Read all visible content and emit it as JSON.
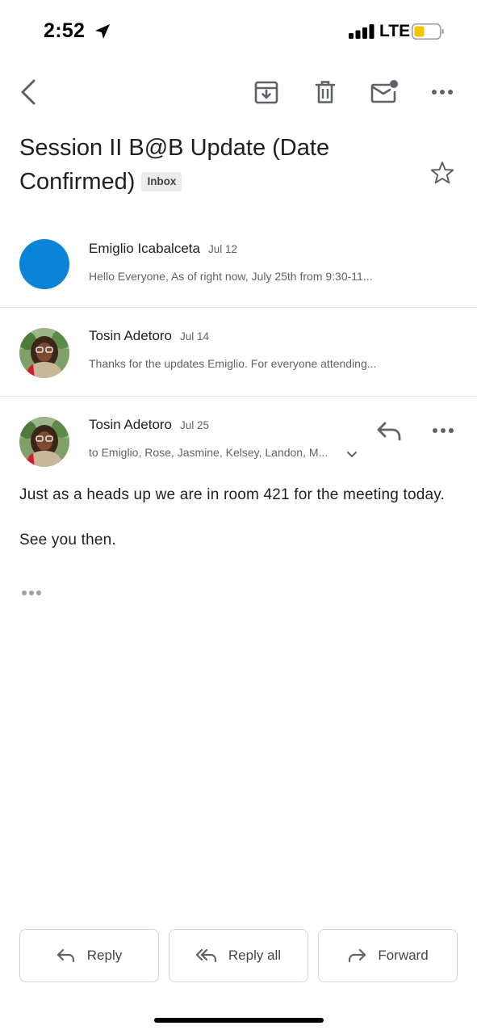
{
  "status_bar": {
    "time": "2:52",
    "network": "LTE"
  },
  "toolbar": {
    "back": "back-icon",
    "archive": "archive-icon",
    "delete": "trash-icon",
    "mark_unread": "mail-unread-icon",
    "more": "more-horizontal-icon"
  },
  "thread": {
    "subject": "Session II B@B Update (Date Confirmed)",
    "label": "Inbox"
  },
  "messages": [
    {
      "sender": "Emiglio Icabalceta",
      "date": "Jul 12",
      "snippet": "Hello Everyone, As of right now, July 25th from 9:30-11...",
      "avatar_color": "#0a84d6"
    },
    {
      "sender": "Tosin Adetoro",
      "date": "Jul 14",
      "snippet": "Thanks for the updates Emiglio. For everyone attending..."
    },
    {
      "sender": "Tosin Adetoro",
      "date": "Jul 25",
      "recipients": "to Emiglio, Rose, Jasmine, Kelsey, Landon, M...",
      "body": [
        "Just as a heads up we are in room 421 for the meeting today.",
        "See you then."
      ]
    }
  ],
  "actions": {
    "reply": "Reply",
    "reply_all": "Reply all",
    "forward": "Forward"
  },
  "colors": {
    "accent_blue": "#0a84d6",
    "battery": "#f5c400"
  }
}
